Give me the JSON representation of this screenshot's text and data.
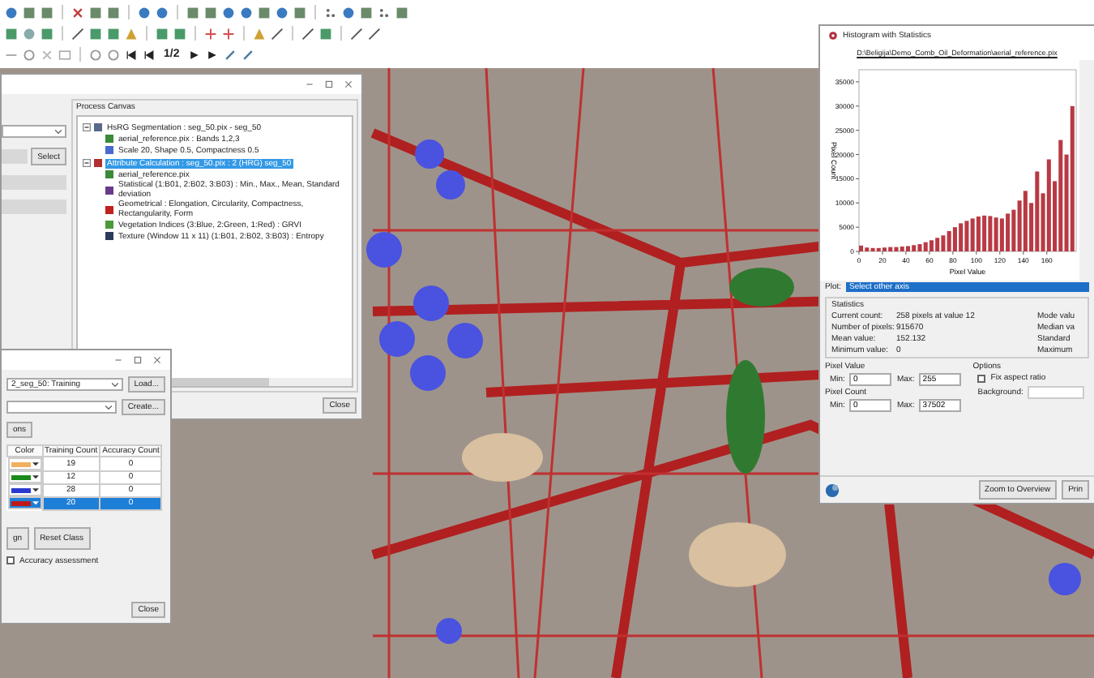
{
  "toolbar": {
    "page_label": "1/2"
  },
  "process_window": {
    "select_button": "Select",
    "canvas_title": "Process Canvas",
    "close_button": "Close",
    "tree": [
      {
        "label": "HsRG Segmentation : seg_50.pix - seg_50",
        "expanded": true,
        "selected": false,
        "color": "#5a6a8a",
        "children": [
          {
            "label": "aerial_reference.pix : Bands 1,2,3",
            "color": "#3a8a3a"
          },
          {
            "label": "Scale 20, Shape 0.5, Compactness 0.5",
            "color": "#4a6ad0"
          }
        ]
      },
      {
        "label": "Attribute Calculation : seg_50.pix : 2 (HRG) seg_50",
        "expanded": true,
        "selected": true,
        "color": "#b03030",
        "children": [
          {
            "label": "aerial_reference.pix",
            "color": "#3a8a3a"
          },
          {
            "label": "Statistical (1:B01, 2:B02, 3:B03) : Min., Max., Mean, Standard deviation",
            "color": "#6a3a8a"
          },
          {
            "label": "Geometrical : Elongation, Circularity, Compactness, Rectangularity, Form",
            "color": "#c02020"
          },
          {
            "label": "Vegetation Indices (3:Blue, 2:Green, 1:Red) : GRVI",
            "color": "#4a9a3a"
          },
          {
            "label": "Texture (Window 11 x 11) (1:B01, 2:B02, 3:B03) : Entropy",
            "color": "#2a3a5a"
          }
        ]
      }
    ]
  },
  "training_window": {
    "scheme_value": "2_seg_50: Training",
    "load_button": "Load...",
    "create_button": "Create...",
    "partial_button": "ons",
    "columns": [
      "Color",
      "Training Count",
      "Accuracy Count"
    ],
    "rows": [
      {
        "color": "#f0b060",
        "training_count": "19",
        "accuracy_count": "0",
        "selected": false
      },
      {
        "color": "#1a8a1a",
        "training_count": "12",
        "accuracy_count": "0",
        "selected": false
      },
      {
        "color": "#2a3ad0",
        "training_count": "28",
        "accuracy_count": "0",
        "selected": false
      },
      {
        "color": "#c01818",
        "training_count": "20",
        "accuracy_count": "0",
        "selected": true
      }
    ],
    "buttons": [
      "gn",
      "Reset Class"
    ],
    "accuracy_checkbox": {
      "label": "Accuracy assessment",
      "checked": false
    },
    "close_button": "Close"
  },
  "histogram_window": {
    "title": "Histogram with Statistics",
    "path": "D:\\Beligija\\Demo_Comb_Oil_Deformation\\aerial_reference.pix",
    "chart_data": {
      "type": "bar",
      "xlabel": "Pixel Value",
      "ylabel": "Pixel Count",
      "x": [
        0,
        5,
        10,
        15,
        20,
        25,
        30,
        35,
        40,
        45,
        50,
        55,
        60,
        65,
        70,
        75,
        80,
        85,
        90,
        95,
        100,
        105,
        110,
        115,
        120,
        125,
        130,
        135,
        140,
        145,
        150,
        155,
        160,
        165,
        170,
        175,
        180
      ],
      "series": [
        {
          "color": "#b83a44",
          "values": [
            1200,
            800,
            700,
            700,
            800,
            900,
            900,
            1000,
            1100,
            1300,
            1500,
            1900,
            2300,
            2800,
            3300,
            4200,
            5000,
            5800,
            6300,
            6800,
            7200,
            7400,
            7300,
            7000,
            6800,
            7800,
            8600,
            10500,
            12500,
            10000,
            16500,
            12000,
            19000,
            14500,
            23000,
            20000,
            30000
          ]
        }
      ],
      "xlim": [
        0,
        185
      ],
      "ylim": [
        0,
        37500
      ],
      "xticks": [
        0,
        20,
        40,
        60,
        80,
        100,
        120,
        140,
        160
      ],
      "yticks": [
        0,
        5000,
        10000,
        15000,
        20000,
        25000,
        30000,
        35000
      ]
    },
    "plot_label": "Plot:",
    "plot_value": "Select other axis",
    "statistics_title": "Statistics",
    "stats": [
      {
        "label": "Current count:",
        "value": "258 pixels at value 12"
      },
      {
        "label": "Number of pixels:",
        "value": "915670"
      },
      {
        "label": "Mean value:",
        "value": "152.132"
      },
      {
        "label": "Minimum value:",
        "value": "0"
      }
    ],
    "right_stats": [
      "Mode valu",
      "Median va",
      "Standard",
      "Maximum"
    ],
    "pixel_value": {
      "title": "Pixel Value",
      "min_label": "Min:",
      "min": "0",
      "max_label": "Max:",
      "max": "255"
    },
    "pixel_count": {
      "title": "Pixel Count",
      "min_label": "Min:",
      "min": "0",
      "max_label": "Max:",
      "max": "37502"
    },
    "options": {
      "title": "Options",
      "fix_aspect": {
        "label": "Fix aspect ratio",
        "checked": false
      },
      "background_label": "Background:"
    },
    "buttons": [
      "Zoom to Overview",
      "Prin"
    ]
  }
}
